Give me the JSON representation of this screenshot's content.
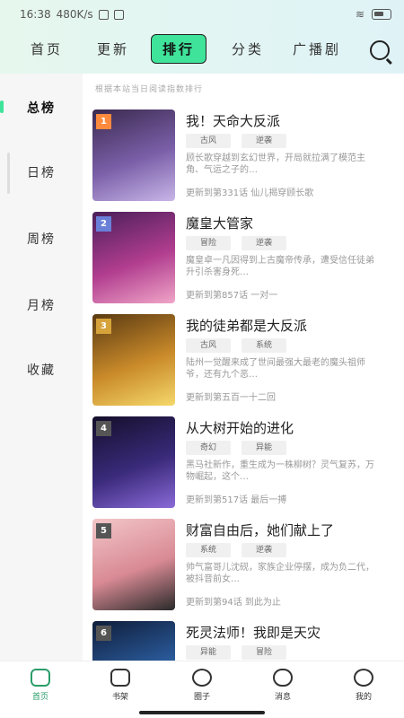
{
  "status": {
    "time": "16:38",
    "speed": "480K/s"
  },
  "nav": {
    "tabs": [
      "首页",
      "更新",
      "排行",
      "分类",
      "广播剧"
    ],
    "active": "排行"
  },
  "sidebar": {
    "items": [
      "总榜",
      "日榜",
      "周榜",
      "月榜",
      "收藏"
    ],
    "active": "总榜"
  },
  "hint": "根据本站当日阅读指数排行",
  "books": [
    {
      "rank": "1",
      "title": "我！天命大反派",
      "tags": [
        "古风",
        "逆袭"
      ],
      "desc": "顾长歌穿越到玄幻世界，开局就拉满了模范主角、气运之子的…",
      "update": "更新到第331话  仙儿揭穿顾长歌",
      "rank_color": "#ff8a3d",
      "cover": [
        "#3b2a4f",
        "#7a5fa8",
        "#c9b6e8"
      ]
    },
    {
      "rank": "2",
      "title": "魔皇大管家",
      "tags": [
        "冒险",
        "逆袭"
      ],
      "desc": "魔皇卓一凡因得到上古魔帝传承，遭受信任徒弟升引杀害身死…",
      "update": "更新到第857话  一对一",
      "rank_color": "#6a7fd8",
      "cover": [
        "#4a1f5a",
        "#b13d8f",
        "#f0a6c8"
      ]
    },
    {
      "rank": "3",
      "title": "我的徒弟都是大反派",
      "tags": [
        "古风",
        "系统"
      ],
      "desc": "陆州一觉醒来成了世间最强大最老的魔头祖师爷，还有九个恶…",
      "update": "更新到第五百一十二回",
      "rank_color": "#d6a23a",
      "cover": [
        "#5a3a12",
        "#c98a2a",
        "#f5d86b"
      ]
    },
    {
      "rank": "4",
      "title": "从大树开始的进化",
      "tags": [
        "奇幻",
        "异能"
      ],
      "desc": "黑马社新作，重生成为一株柳树？灵气复苏，万物崛起，这个…",
      "update": "更新到第517话  最后一搏",
      "rank_color": "#555555",
      "cover": [
        "#140f2a",
        "#3a2a7a",
        "#8a6ad8"
      ]
    },
    {
      "rank": "5",
      "title": "财富自由后，她们献上了",
      "tags": [
        "系统",
        "逆袭"
      ],
      "desc": "帅气富哥儿沈砚，家族企业停摆，成为负二代，被抖音前女…",
      "update": "更新到第94话  到此为止",
      "rank_color": "#555555",
      "cover": [
        "#f2c6c8",
        "#d98a94",
        "#2a2a2a"
      ]
    },
    {
      "rank": "6",
      "title": "死灵法师！我即是天灾",
      "tags": [
        "异能",
        "冒险"
      ],
      "desc": "",
      "update": "",
      "rank_color": "#555555",
      "cover": [
        "#0f1d3a",
        "#2a5a9a",
        "#6ab0e8"
      ]
    }
  ],
  "bottom_nav": {
    "items": [
      "首页",
      "书架",
      "圈子",
      "消息",
      "我的"
    ],
    "active": "首页"
  }
}
